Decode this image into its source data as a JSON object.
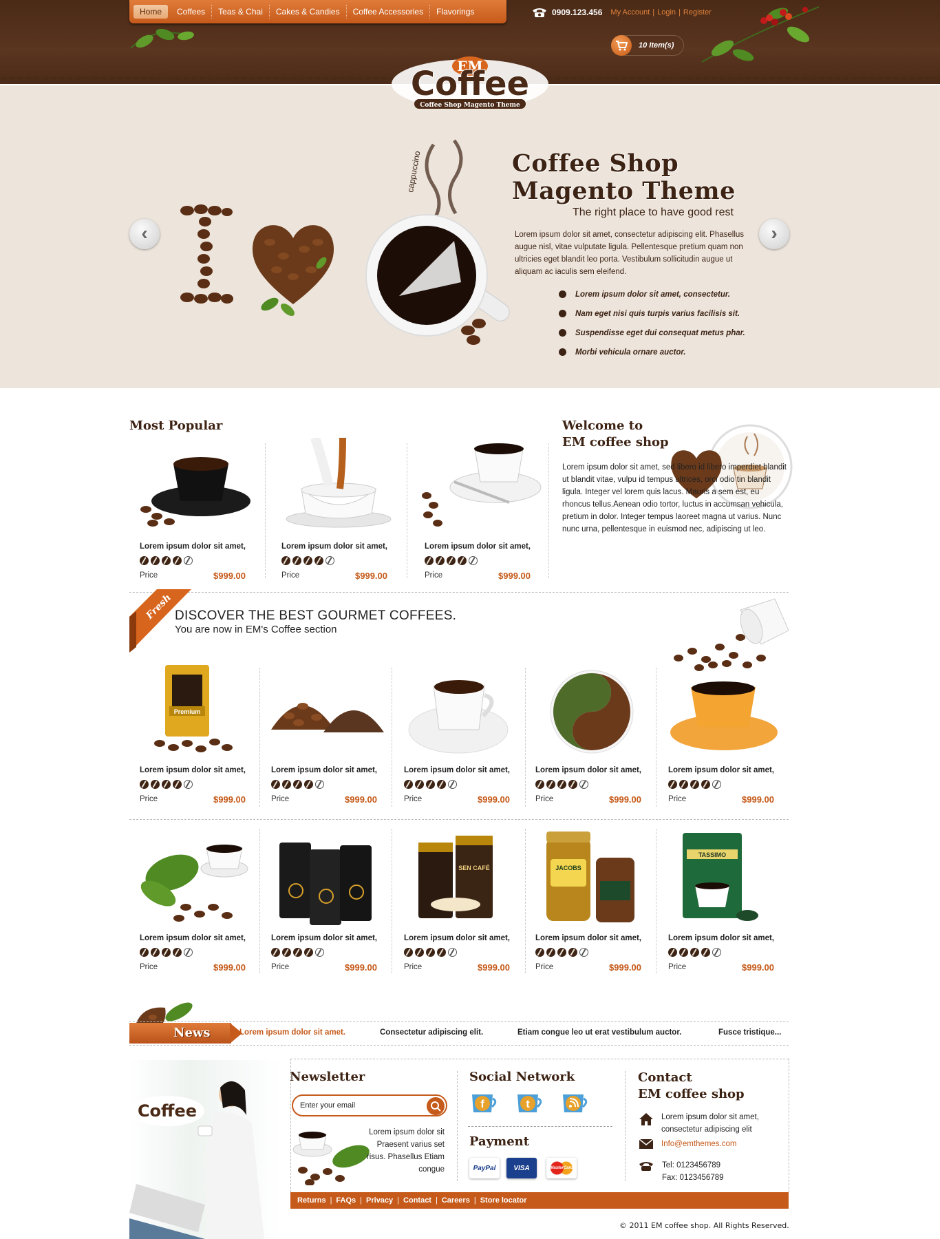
{
  "nav": {
    "items": [
      "Home",
      "Coffees",
      "Teas & Chai",
      "Cakes & Candies",
      "Coffee Accessories",
      "Flavorings"
    ],
    "active": "Home"
  },
  "topbar": {
    "phone": "0909.123.456",
    "links": [
      "My Account",
      "Login",
      "Register"
    ],
    "cart": "10 Item(s)"
  },
  "logo": {
    "top": "EM",
    "main": "Coffee",
    "tagline": "Coffee Shop Magento Theme"
  },
  "hero": {
    "title_line1": "Coffee Shop",
    "title_line2": "Magento Theme",
    "subtitle": "The right place to have good rest",
    "body": "Lorem ipsum dolor sit amet, consectetur adipiscing elit. Phasellus augue nisl, vitae vulputate ligula. Pellentesque pretium quam non ultricies eget blandit leo porta. Vestibulum sollicitudin augue ut aliquam ac iaculis sem eleifend.",
    "bullets": [
      "Lorem ipsum dolor sit amet, consectetur.",
      "Nam eget nisi quis turpis varius facilisis sit.",
      "Suspendisse eget dui consequat metus phar.",
      "Morbi vehicula ornare auctor."
    ],
    "prev_icon": "chevron-left-icon",
    "next_icon": "chevron-right-icon",
    "cup_steam_text": "cappuccino"
  },
  "popular": {
    "title": "Most Popular",
    "products": [
      {
        "name": "Lorem ipsum dolor sit amet,",
        "rating": 4,
        "price_label": "Price",
        "price": "$999.00"
      },
      {
        "name": "Lorem ipsum dolor sit amet,",
        "rating": 4,
        "price_label": "Price",
        "price": "$999.00"
      },
      {
        "name": "Lorem ipsum dolor sit amet,",
        "rating": 4,
        "price_label": "Price",
        "price": "$999.00"
      }
    ]
  },
  "welcome": {
    "title_line1": "Welcome to",
    "title_line2": "EM coffee shop",
    "text": "Lorem ipsum dolor sit amet, sed libero id libero imperdiet blandit ut blandit vitae, vulpu id tempus ultrices, orci odio tin blandit ligula. Integer vel lorem quis lacus. Mauris a sem est, eu rhoncus tellus.Aenean odio tortor, luctus in accumsan vehicula, pretium in dolor. Integer tempus laoreet magna ut varius. Nunc nunc urna, pellentesque in euismod nec, adipiscing ut leo."
  },
  "discover": {
    "ribbon": "Fresh",
    "title": "DISCOVER THE BEST GOURMET COFFEES.",
    "subtitle": "You are now in EM's Coffee section"
  },
  "grid": {
    "row1": [
      {
        "name": "Lorem ipsum dolor sit amet,",
        "rating": 4,
        "price_label": "Price",
        "price": "$999.00",
        "image_text": "Premium"
      },
      {
        "name": "Lorem ipsum dolor sit amet,",
        "rating": 4,
        "price_label": "Price",
        "price": "$999.00",
        "image_text": ""
      },
      {
        "name": "Lorem ipsum dolor sit amet,",
        "rating": 4,
        "price_label": "Price",
        "price": "$999.00",
        "image_text": ""
      },
      {
        "name": "Lorem ipsum dolor sit amet,",
        "rating": 4,
        "price_label": "Price",
        "price": "$999.00",
        "image_text": ""
      },
      {
        "name": "Lorem ipsum dolor sit amet,",
        "rating": 4,
        "price_label": "Price",
        "price": "$999.00",
        "image_text": ""
      }
    ],
    "row2": [
      {
        "name": "Lorem ipsum dolor sit amet,",
        "rating": 4,
        "price_label": "Price",
        "price": "$999.00",
        "image_text": ""
      },
      {
        "name": "Lorem ipsum dolor sit amet,",
        "rating": 4,
        "price_label": "Price",
        "price": "$999.00",
        "image_text": ""
      },
      {
        "name": "Lorem ipsum dolor sit amet,",
        "rating": 4,
        "price_label": "Price",
        "price": "$999.00",
        "image_text": "SEN CAFÉ"
      },
      {
        "name": "Lorem ipsum dolor sit amet,",
        "rating": 4,
        "price_label": "Price",
        "price": "$999.00",
        "image_text": "JACOBS"
      },
      {
        "name": "Lorem ipsum dolor sit amet,",
        "rating": 4,
        "price_label": "Price",
        "price": "$999.00",
        "image_text": "TASSIMO"
      }
    ]
  },
  "news": {
    "label": "News",
    "items": [
      "Lorem ipsum dolor sit amet.",
      "Consectetur adipiscing elit.",
      "Etiam congue leo ut erat vestibulum auctor.",
      "Fusce tristique..."
    ]
  },
  "footer": {
    "newsletter_title": "Newsletter",
    "newsletter_placeholder": "Enter your email",
    "newsletter_text": "Lorem ipsum dolor sit Praesent varius set risus. Phasellus Etiam congue",
    "social_title": "Social Network",
    "social_icons": [
      "facebook-icon",
      "twitter-icon",
      "rss-icon"
    ],
    "payment_title": "Payment",
    "payments": [
      "PayPal",
      "VISA",
      "MasterCard"
    ],
    "contact_title_line1": "Contact",
    "contact_title_line2": "EM coffee shop",
    "address": "Lorem ipsum dolor sit amet, consectetur adipiscing elit",
    "email": "Info@emthemes.com",
    "tel": "Tel: 0123456789",
    "fax": "Fax: 0123456789",
    "links": [
      "Returns",
      "FAQs",
      "Privacy",
      "Contact",
      "Careers",
      "Store locator"
    ],
    "copyright": "© 2011 EM coffee shop. All Rights Reserved."
  },
  "colors": {
    "header_brown": "#4a2a16",
    "accent_orange": "#c65a1a",
    "hero_bg": "#ede5dc",
    "text_brown": "#3d2314"
  }
}
